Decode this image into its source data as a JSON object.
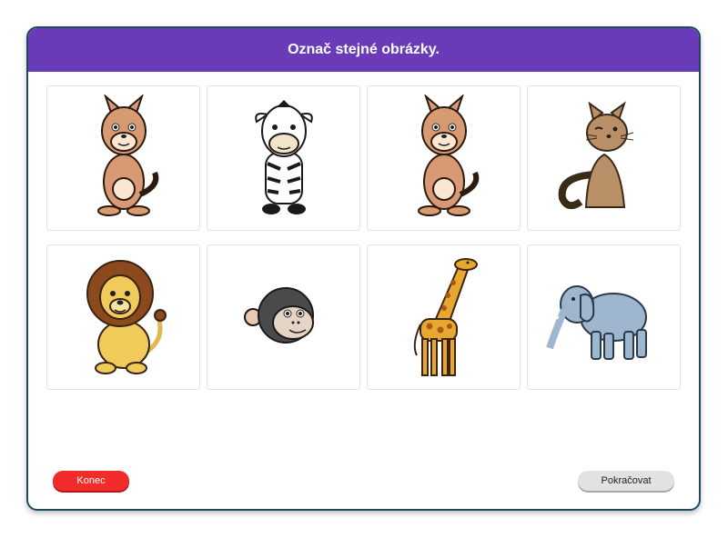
{
  "header": {
    "title": "Označ stejné obrázky."
  },
  "cards": [
    {
      "animal": "kangaroo-icon"
    },
    {
      "animal": "zebra-icon"
    },
    {
      "animal": "kangaroo-icon"
    },
    {
      "animal": "cat-icon"
    },
    {
      "animal": "lion-icon"
    },
    {
      "animal": "monkey-icon"
    },
    {
      "animal": "giraffe-icon"
    },
    {
      "animal": "elephant-icon"
    }
  ],
  "buttons": {
    "end_label": "Konec",
    "next_label": "Pokračovat"
  },
  "colors": {
    "header": "#6a3bb8",
    "end_button": "#f22b2b",
    "next_button": "#e2e2e2"
  }
}
